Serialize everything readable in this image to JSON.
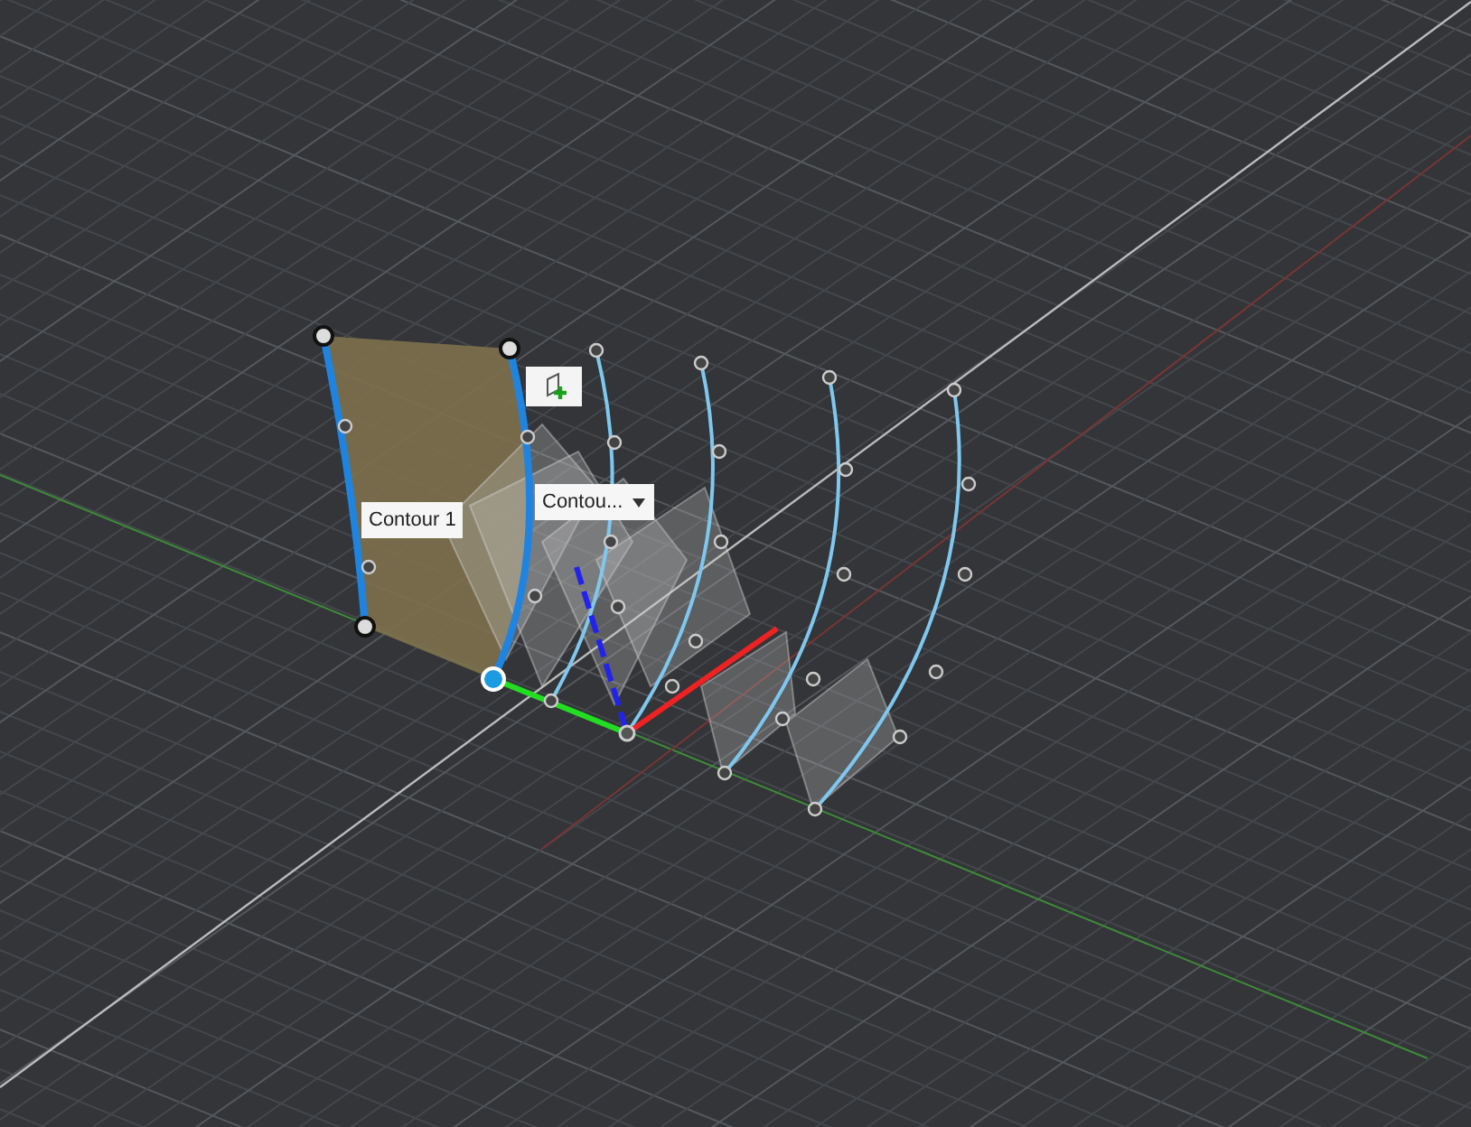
{
  "viewport": {
    "labels": [
      {
        "kind": "tag",
        "text": "Contour 1"
      },
      {
        "kind": "dropdown",
        "text": "Contou..."
      }
    ]
  }
}
